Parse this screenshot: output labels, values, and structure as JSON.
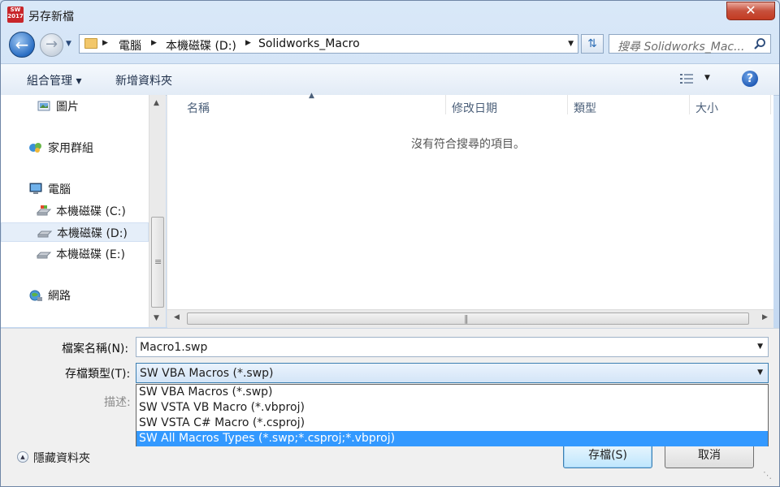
{
  "window": {
    "title": "另存新檔",
    "app_icon_text": "SW 2017",
    "close_label": "✕"
  },
  "nav": {
    "breadcrumbs": [
      "電腦",
      "本機磁碟 (D:)",
      "Solidworks_Macro"
    ],
    "search_placeholder": "搜尋 Solidworks_Mac..."
  },
  "toolbar": {
    "organize_label": "組合管理 ▾",
    "new_folder_label": "新增資料夾"
  },
  "sidebar": {
    "items": [
      {
        "label": "圖片",
        "icon": "pictures-icon"
      },
      {
        "label": "家用群組",
        "icon": "homegroup-icon"
      },
      {
        "label": "電腦",
        "icon": "computer-icon"
      },
      {
        "label": "本機磁碟 (C:)",
        "icon": "drive-c-icon"
      },
      {
        "label": "本機磁碟 (D:)",
        "icon": "drive-d-icon",
        "selected": true
      },
      {
        "label": "本機磁碟 (E:)",
        "icon": "drive-e-icon"
      },
      {
        "label": "網路",
        "icon": "network-icon"
      }
    ]
  },
  "filelist": {
    "columns": [
      "名稱",
      "修改日期",
      "類型",
      "大小"
    ],
    "empty_message": "沒有符合搜尋的項目。"
  },
  "form": {
    "filename_label": "檔案名稱(N):",
    "filename_value": "Macro1.swp",
    "filetype_label": "存檔類型(T):",
    "filetype_value": "SW VBA Macros (*.swp)",
    "description_label": "描述:",
    "filetype_options": [
      "SW VBA Macros (*.swp)",
      "SW VSTA VB Macro (*.vbproj)",
      "SW VSTA C# Macro (*.csproj)",
      "SW All Macros Types (*.swp;*.csproj;*.vbproj)"
    ],
    "highlighted_option": "SW All Macros Types (*.swp;*.csproj;*.vbproj)"
  },
  "footer": {
    "hide_folders_label": "隱藏資料夾",
    "save_label": "存檔(S)",
    "cancel_label": "取消"
  },
  "colors": {
    "highlight": "#3399ff",
    "close_button": "#c7503c"
  }
}
